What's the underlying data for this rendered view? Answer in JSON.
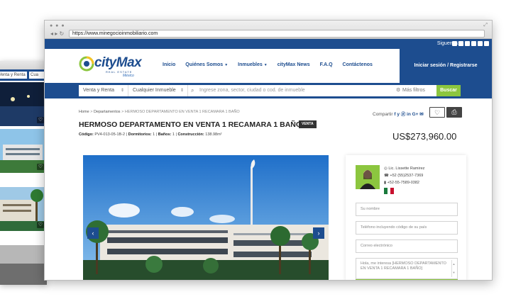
{
  "back_window": {
    "filter_primary": "Venta y Renta",
    "filter_secondary": "Cua"
  },
  "browser": {
    "url": "https://www.minegocioinmobiliario.com"
  },
  "social_bar": {
    "label": "Siguenos:",
    "icons": [
      "facebook-icon",
      "twitter-icon",
      "linkedin-icon",
      "google-plus-icon",
      "instagram-icon",
      "youtube-icon"
    ]
  },
  "logo": {
    "brand": "cityMax",
    "tagline": "REAL ESTATE",
    "region": "México"
  },
  "nav": {
    "items": [
      {
        "label": "Inicio",
        "dropdown": false
      },
      {
        "label": "Quiénes Somos",
        "dropdown": true
      },
      {
        "label": "Inmuebles",
        "dropdown": true
      },
      {
        "label": "cityMax News",
        "dropdown": false
      },
      {
        "label": "F.A.Q",
        "dropdown": false
      },
      {
        "label": "Contáctenos",
        "dropdown": false
      }
    ],
    "login": "Iniciar sesión / Registrarse"
  },
  "search": {
    "operation": "Venta y Renta",
    "property_type": "Cualquier Inmueble",
    "placeholder": "Ingrese zona, sector, ciudad o cod. de inmueble",
    "filters": "Más filtros",
    "button": "Buscar"
  },
  "breadcrumb": {
    "home": "Home",
    "section": "Departamentos",
    "current": "HERMOSO DEPARTAMENTO EN VENTA 1 RECAMARA 1 BAÑO"
  },
  "share": {
    "label": "Compartir",
    "icons": "f y ⓟ in G+ ✉"
  },
  "listing": {
    "title": "HERMOSO DEPARTAMENTO EN VENTA 1 RECAMARA 1 BAÑO",
    "badge": "VENTA",
    "code_label": "Código:",
    "code": "PV4-013-05-1B-2",
    "bedrooms_label": "Dormitorios:",
    "bedrooms": "1",
    "baths_label": "Baños:",
    "baths": "1",
    "construction_label": "Construcción:",
    "construction": "138.98m²",
    "price": "US$273,960.00"
  },
  "agent": {
    "name": "Lic. Lissette Ramirez",
    "phone1": "+52 (55)2537-7369",
    "phone2": "+52-55-7589-0382"
  },
  "form": {
    "name_placeholder": "Su nombre",
    "phone_placeholder": "Teléfono incluyendo código de su país",
    "email_placeholder": "Correo electrónico",
    "message": "Hola, me interesa [HERMOSO DEPARTAMENTO EN VENTA 1 RECAMARA 1 BAÑO]"
  },
  "colors": {
    "brand_blue": "#1d4d8f",
    "accent_green": "#8cc63f"
  }
}
